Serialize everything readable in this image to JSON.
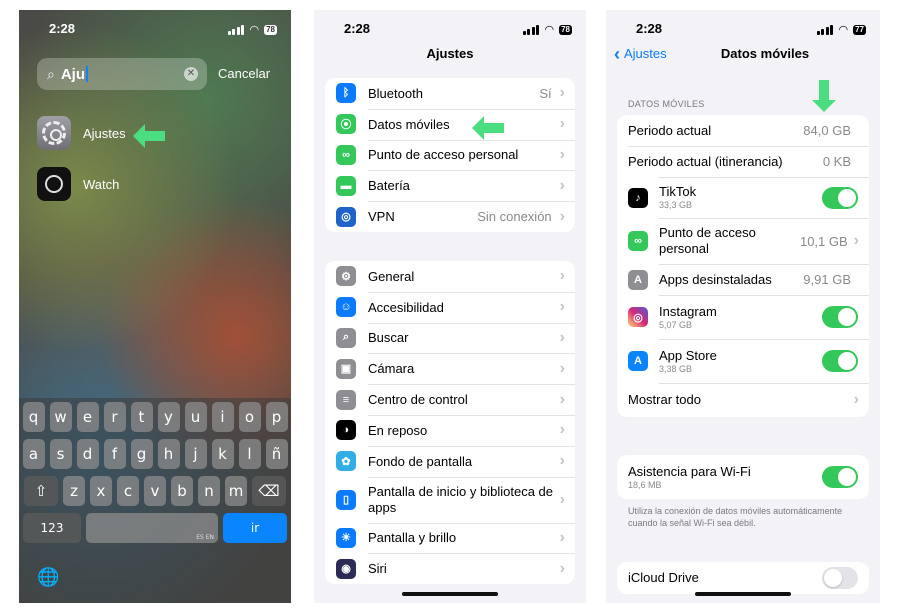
{
  "status": {
    "time": "2:28",
    "battery_p1": "78",
    "battery_p2": "78",
    "battery_p3": "77"
  },
  "spotlight": {
    "query": "Aju",
    "cancel_label": "Cancelar",
    "results": [
      {
        "label": "Ajustes",
        "icon": "settings-gear-icon"
      },
      {
        "label": "Watch",
        "icon": "watch-icon"
      }
    ]
  },
  "keyboard": {
    "row1": [
      "q",
      "w",
      "e",
      "r",
      "t",
      "y",
      "u",
      "i",
      "o",
      "p"
    ],
    "row2": [
      "a",
      "s",
      "d",
      "f",
      "g",
      "h",
      "j",
      "k",
      "l",
      "ñ"
    ],
    "row3": [
      "z",
      "x",
      "c",
      "v",
      "b",
      "n",
      "m"
    ],
    "num_label": "123",
    "space_lang": "ES EN",
    "go_label": "ir"
  },
  "settings": {
    "title": "Ajustes",
    "group1": [
      {
        "label": "Bluetooth",
        "value": "Sí",
        "icon": "bluetooth-icon",
        "color": "#0a7aff"
      },
      {
        "label": "Datos móviles",
        "value": "",
        "icon": "antenna-icon",
        "color": "#34c759"
      },
      {
        "label": "Punto de acceso personal",
        "value": "",
        "icon": "link-icon",
        "color": "#34c759"
      },
      {
        "label": "Batería",
        "value": "",
        "icon": "battery-icon",
        "color": "#34c759"
      },
      {
        "label": "VPN",
        "value": "Sin conexión",
        "icon": "globe-icon",
        "color": "#1e63c9"
      }
    ],
    "group2": [
      {
        "label": "General",
        "icon": "gear-icon",
        "color": "#8e8e93"
      },
      {
        "label": "Accesibilidad",
        "icon": "accessibility-icon",
        "color": "#0a7aff"
      },
      {
        "label": "Buscar",
        "icon": "search-icon",
        "color": "#8e8e93"
      },
      {
        "label": "Cámara",
        "icon": "camera-icon",
        "color": "#8e8e93"
      },
      {
        "label": "Centro de control",
        "icon": "toggles-icon",
        "color": "#8e8e93"
      },
      {
        "label": "En reposo",
        "icon": "standby-icon",
        "color": "#000000"
      },
      {
        "label": "Fondo de pantalla",
        "icon": "flower-icon",
        "color": "#32ade6"
      },
      {
        "label": "Pantalla de inicio y biblioteca de apps",
        "icon": "phone-grid-icon",
        "color": "#0a7aff"
      },
      {
        "label": "Pantalla y brillo",
        "icon": "sun-icon",
        "color": "#0a7aff"
      },
      {
        "label": "Siri",
        "icon": "siri-icon",
        "color": "#2b2b55"
      }
    ]
  },
  "mobile_data": {
    "back_label": "Ajustes",
    "title": "Datos móviles",
    "section_header": "DATOS MÓVILES",
    "current_period_label": "Periodo actual",
    "current_period_value": "84,0 GB",
    "roaming_label": "Periodo actual (itinerancia)",
    "roaming_value": "0 KB",
    "apps": [
      {
        "name": "TikTok",
        "size": "33,3 GB",
        "on": true,
        "icon": "tiktok-icon",
        "color": "#000000"
      },
      {
        "name": "Punto de acceso personal",
        "size": "",
        "value": "10,1 GB",
        "icon": "link-icon",
        "color": "#34c759"
      },
      {
        "name": "Apps desinstaladas",
        "value": "9,91 GB",
        "icon": "app-store-gray-icon",
        "color": "#8e8e93"
      },
      {
        "name": "Instagram",
        "size": "5,07 GB",
        "on": true,
        "icon": "instagram-icon",
        "color": "#d62976"
      },
      {
        "name": "App Store",
        "size": "3,38 GB",
        "on": true,
        "icon": "app-store-icon",
        "color": "#0a84ff"
      }
    ],
    "show_all_label": "Mostrar todo",
    "wifi_assist_label": "Asistencia para Wi-Fi",
    "wifi_assist_size": "18,6 MB",
    "wifi_assist_note": "Utiliza la conexión de datos móviles automáticamente cuando la señal Wi-Fi sea débil.",
    "icloud_label": "iCloud Drive"
  },
  "accent_green": "#4ade80"
}
